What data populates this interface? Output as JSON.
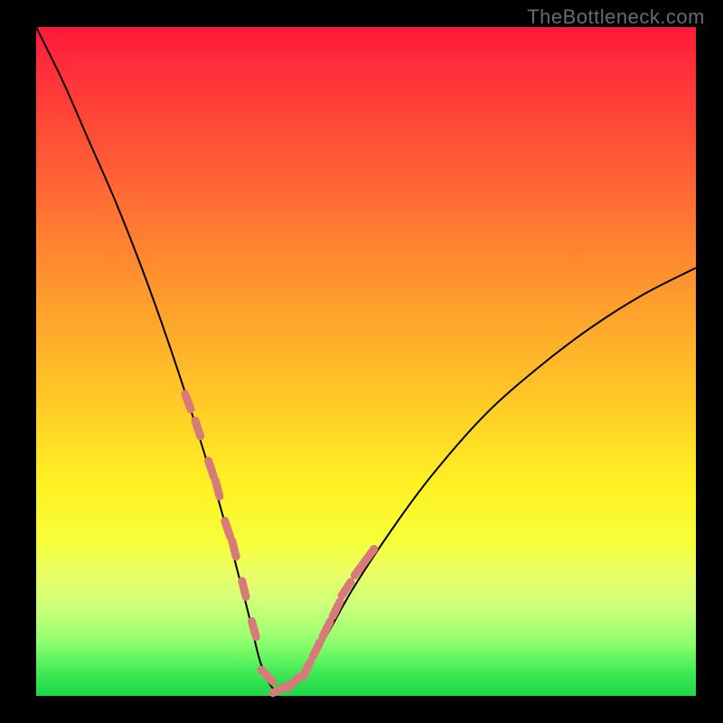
{
  "watermark": "TheBottleneck.com",
  "colors": {
    "frame": "#000000",
    "gradient_top": "#ff1a3a",
    "gradient_bottom": "#1ed64a",
    "curve": "#000000",
    "markers": "#d97a7a"
  },
  "chart_data": {
    "type": "line",
    "title": "",
    "xlabel": "",
    "ylabel": "",
    "xlim": [
      0,
      100
    ],
    "ylim": [
      0,
      100
    ],
    "grid": false,
    "notes": "V-shaped bottleneck curve; y≈0 optimal (green) near x≈36; rises toward 100 (red) at edges. Pink markers cluster along both branches near the valley (roughly x 23–50).",
    "series": [
      {
        "name": "bottleneck-curve",
        "x": [
          0,
          4,
          8,
          12,
          16,
          20,
          24,
          28,
          32,
          34,
          36,
          38,
          40,
          44,
          48,
          54,
          60,
          68,
          76,
          84,
          92,
          100
        ],
        "y": [
          100,
          92,
          83,
          74,
          64,
          53,
          41,
          28,
          13,
          5,
          1,
          1,
          3,
          9,
          16,
          25,
          33,
          42,
          49,
          55,
          60,
          64
        ]
      }
    ],
    "markers": {
      "name": "highlighted-points",
      "x": [
        23,
        24.5,
        26.5,
        27.5,
        29,
        30,
        31.5,
        33,
        35,
        37,
        39,
        41,
        42.5,
        44,
        45.5,
        47,
        49,
        50.5
      ],
      "y": [
        44,
        40,
        34,
        31,
        25,
        22,
        16,
        10,
        3,
        1,
        2,
        4,
        7,
        10,
        13,
        16,
        19,
        21
      ]
    }
  }
}
